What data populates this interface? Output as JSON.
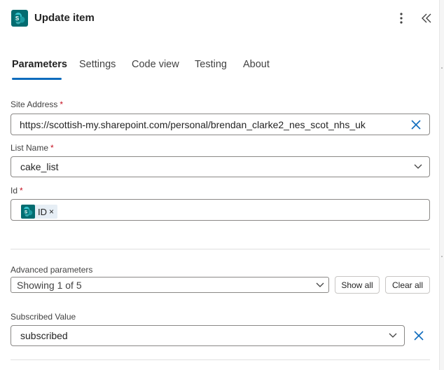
{
  "header": {
    "title": "Update item",
    "icon": "sharepoint-icon",
    "more_icon": "more-vertical-icon",
    "collapse_icon": "double-chevron-left-icon"
  },
  "tabs": [
    {
      "label": "Parameters",
      "active": true
    },
    {
      "label": "Settings",
      "active": false
    },
    {
      "label": "Code view",
      "active": false
    },
    {
      "label": "Testing",
      "active": false
    },
    {
      "label": "About",
      "active": false
    }
  ],
  "fields": {
    "site_address": {
      "label": "Site Address",
      "required_mark": "*",
      "value": "https://scottish-my.sharepoint.com/personal/brendan_clarke2_nes_scot_nhs_uk"
    },
    "list_name": {
      "label": "List Name",
      "required_mark": "*",
      "value": "cake_list"
    },
    "id": {
      "label": "Id",
      "required_mark": "*",
      "token_label": "ID",
      "token_remove": "×"
    }
  },
  "advanced": {
    "label": "Advanced parameters",
    "select_value": "Showing 1 of 5",
    "show_all": "Show all",
    "clear_all": "Clear all"
  },
  "subscribed": {
    "label": "Subscribed Value",
    "value": "subscribed"
  },
  "colors": {
    "accent": "#0f6cbd",
    "sharepoint": "#036c70",
    "required": "#c50f1f"
  }
}
